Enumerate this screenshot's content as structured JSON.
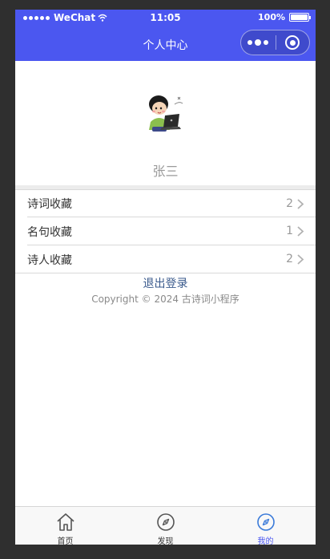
{
  "status_bar": {
    "carrier": "WeChat",
    "time": "11:05",
    "battery_text": "100%",
    "battery_level": 1.0
  },
  "nav": {
    "title": "个人中心",
    "color": "#4b57f0"
  },
  "profile": {
    "name": "张三",
    "avatar_icon": "cartoon-boy-with-laptop"
  },
  "menu": [
    {
      "label": "诗词收藏",
      "count": "2"
    },
    {
      "label": "名句收藏",
      "count": "1"
    },
    {
      "label": "诗人收藏",
      "count": "2"
    }
  ],
  "logout_label": "退出登录",
  "copyright": "Copyright © 2024 古诗词小程序",
  "tabs": [
    {
      "label": "首页",
      "icon": "home-icon",
      "active": false
    },
    {
      "label": "发现",
      "icon": "compass-icon",
      "active": false
    },
    {
      "label": "我的",
      "icon": "compass-icon",
      "active": true
    }
  ],
  "colors": {
    "accent": "#4b57f0",
    "link": "#3a5a8c",
    "muted": "#999999"
  }
}
